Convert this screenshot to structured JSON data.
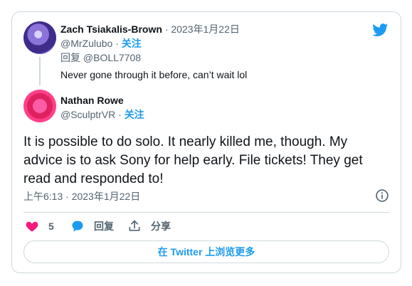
{
  "parent_tweet": {
    "display_name": "Zach Tsiakalis-Brown",
    "separator": " · ",
    "date": "2023年1月22日",
    "handle": "@MrZulubo",
    "follow_label": "关注",
    "reply_to": "回复 @BOLL7708",
    "text": "Never gone through it before, can’t wait lol"
  },
  "main_tweet": {
    "display_name": "Nathan Rowe",
    "handle": "@SculptrVR",
    "follow_label": "关注",
    "text": "It is possible to do solo. It nearly killed me, though. My advice is to ask Sony for help early. File tickets! They get read and responded to!",
    "timestamp": "上午6:13 · 2023年1月22日"
  },
  "actions": {
    "like_count": "5",
    "reply_label": "回复",
    "share_label": "分享"
  },
  "read_more_label": "在 Twitter 上浏览更多",
  "colors": {
    "accent": "#1d9bf0",
    "like": "#f91880",
    "muted": "#536471",
    "border": "#cfd9de"
  }
}
